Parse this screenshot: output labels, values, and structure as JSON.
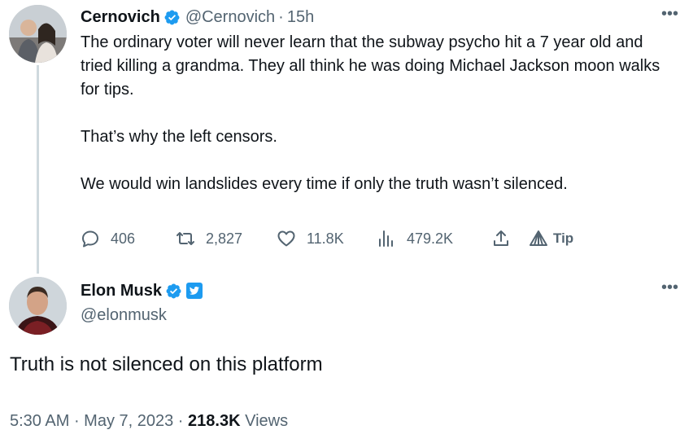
{
  "tweet1": {
    "display_name": "Cernovich",
    "handle": "@Cernovich",
    "separator": "·",
    "time": "15h",
    "more_icon": "more-horizontal-icon",
    "avatar_icon": "avatar-photo",
    "paragraphs": [
      "The ordinary voter will never learn that the subway psycho hit a 7 year old and tried killing a grandma. They all think he was doing Michael Jackson moon walks for tips.",
      "That’s why the left censors.",
      "We would win landslides every time if only the truth wasn’t silenced."
    ],
    "actions": {
      "replies": "406",
      "retweets": "2,827",
      "likes": "11.8K",
      "views": "479.2K",
      "tip": "Tip"
    }
  },
  "tweet2": {
    "display_name": "Elon Musk",
    "handle": "@elonmusk",
    "more_icon": "more-horizontal-icon",
    "text": "Truth is not silenced on this platform",
    "time": "5:30 AM",
    "sep1": " · ",
    "date": "May 7, 2023",
    "sep2": " · ",
    "views_count": "218.3K",
    "views_label": " Views"
  },
  "colors": {
    "text": "#0f1419",
    "secondary": "#536471",
    "verified_blue": "#1d9bf0",
    "thread_line": "#cfd9de"
  }
}
